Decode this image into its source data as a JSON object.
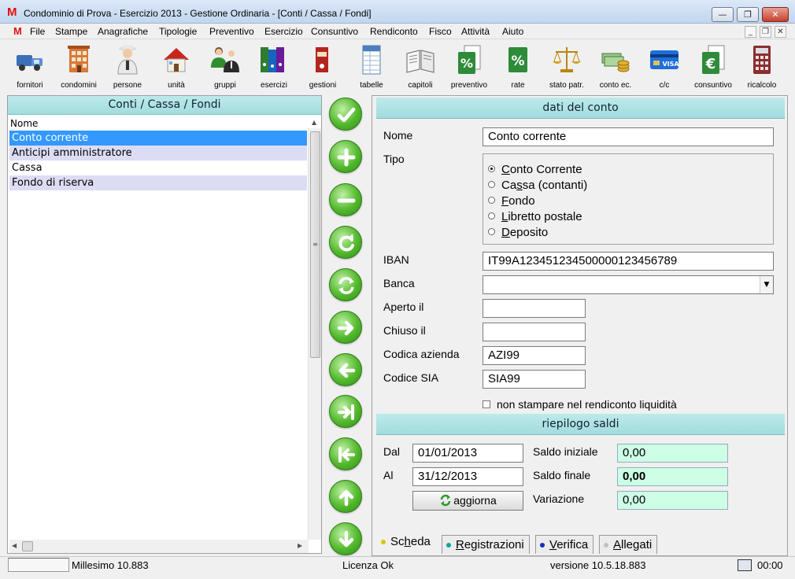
{
  "window": {
    "title": "Condominio di Prova - Esercizio 2013 - Gestione Ordinaria - [Conti / Cassa / Fondi]",
    "logo": "M"
  },
  "menu": [
    "File",
    "Stampe",
    "Anagrafiche",
    "Tipologie",
    "Preventivo",
    "Esercizio",
    "Consuntivo",
    "Rendiconto",
    "Fisco",
    "Attività",
    "Aiuto"
  ],
  "toolbar": [
    {
      "label": "fornitori",
      "icon": "truck-icon"
    },
    {
      "label": "condomini",
      "icon": "building-icon"
    },
    {
      "label": "persone",
      "icon": "person-icon"
    },
    {
      "label": "unità",
      "icon": "house-icon"
    },
    {
      "label": "gruppi",
      "icon": "group-icon"
    },
    {
      "label": "esercizi",
      "icon": "binders-icon"
    },
    {
      "label": "gestioni",
      "icon": "binder-icon"
    },
    {
      "label": "tabelle",
      "icon": "table-icon"
    },
    {
      "label": "capitoli",
      "icon": "open-book-icon"
    },
    {
      "label": "preventivo",
      "icon": "percent-doc-icon"
    },
    {
      "label": "rate",
      "icon": "percent-icon"
    },
    {
      "label": "stato patr.",
      "icon": "scales-icon"
    },
    {
      "label": "conto ec.",
      "icon": "coins-icon"
    },
    {
      "label": "c/c",
      "icon": "credit-card-icon"
    },
    {
      "label": "consuntivo",
      "icon": "euro-doc-icon"
    },
    {
      "label": "ricalcolo",
      "icon": "calculator-icon"
    }
  ],
  "left": {
    "title": "Conti / Cassa / Fondi",
    "column": "Nome",
    "rows": [
      "Conto corrente",
      "Anticipi amministratore",
      "Cassa",
      "Fondo di riserva"
    ]
  },
  "nav_buttons": [
    "check-icon",
    "add-icon",
    "remove-icon",
    "refresh-icon",
    "reload-icon",
    "arrow-right-icon",
    "arrow-left-icon",
    "last-icon",
    "first-icon",
    "arrow-up-icon",
    "arrow-down-icon"
  ],
  "right": {
    "header": "dati del conto",
    "nome_label": "Nome",
    "nome_value": "Conto corrente",
    "tipo_label": "Tipo",
    "tipo_options": [
      {
        "pre": "",
        "u": "C",
        "post": "onto Corrente"
      },
      {
        "pre": "Ca",
        "u": "s",
        "post": "sa (contanti)"
      },
      {
        "pre": "",
        "u": "F",
        "post": "ondo"
      },
      {
        "pre": "",
        "u": "L",
        "post": "ibretto postale"
      },
      {
        "pre": "",
        "u": "D",
        "post": "eposito"
      }
    ],
    "tipo_selected": 0,
    "iban_label": "IBAN",
    "iban_value": "IT99A123451234500000123456789",
    "banca_label": "Banca",
    "banca_value": "",
    "aperto_label": "Aperto il",
    "aperto_value": "",
    "chiuso_label": "Chiuso il",
    "chiuso_value": "",
    "azienda_label": "Codica azienda",
    "azienda_value": "AZI99",
    "sia_label": "Codice SIA",
    "sia_value": "SIA99",
    "checkbox_label": "non stampare nel rendiconto liquidità",
    "checkbox_checked": false,
    "saldi_header": "riepilogo saldi",
    "dal_label": "Dal",
    "dal_value": "01/01/2013",
    "al_label": "Al",
    "al_value": "31/12/2013",
    "aggiorna_label": "aggiorna",
    "saldo_iniziale_label": "Saldo iniziale",
    "saldo_iniziale_value": "0,00",
    "saldo_finale_label": "Saldo finale",
    "saldo_finale_value": "0,00",
    "variazione_label": "Variazione",
    "variazione_value": "0,00"
  },
  "tabs": [
    {
      "pre": "Sc",
      "u": "h",
      "post": "eda",
      "dot": "#d8c800"
    },
    {
      "pre": "",
      "u": "R",
      "post": "egistrazioni",
      "dot": "#00a8a8"
    },
    {
      "pre": "",
      "u": "V",
      "post": "erifica",
      "dot": "#1030c0"
    },
    {
      "pre": "",
      "u": "A",
      "post": "llegati",
      "dot": "#c0c0c0"
    }
  ],
  "status": {
    "millesimo": "Millesimo 10.883",
    "licenza": "Licenza Ok",
    "versione": "versione 10.5.18.883",
    "time": "00:00"
  },
  "colors": {
    "section_header": "#a9e0e1",
    "selected_row": "#3399ff",
    "alt_row": "#dcdcf4",
    "saldo_field": "#ccffe6",
    "nav_button": "#52b82c"
  }
}
